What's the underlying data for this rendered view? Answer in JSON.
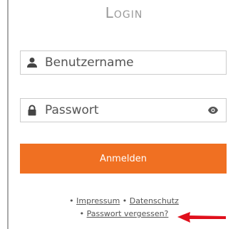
{
  "login": {
    "title": "Login",
    "username_placeholder": "Benutzername",
    "password_placeholder": "Passwort",
    "submit_label": "Anmelden"
  },
  "footer": {
    "bullet": "•",
    "impressum_label": "Impressum",
    "datenschutz_label": "Datenschutz",
    "forgot_password_label": "Passwort vergessen?"
  },
  "icons": {
    "username": "user-icon",
    "password": "lock-icon",
    "show_password": "eye-icon",
    "annotation": "red-arrow-icon"
  },
  "colors": {
    "accent": "#f07022",
    "annotation_arrow": "#e0101c"
  }
}
